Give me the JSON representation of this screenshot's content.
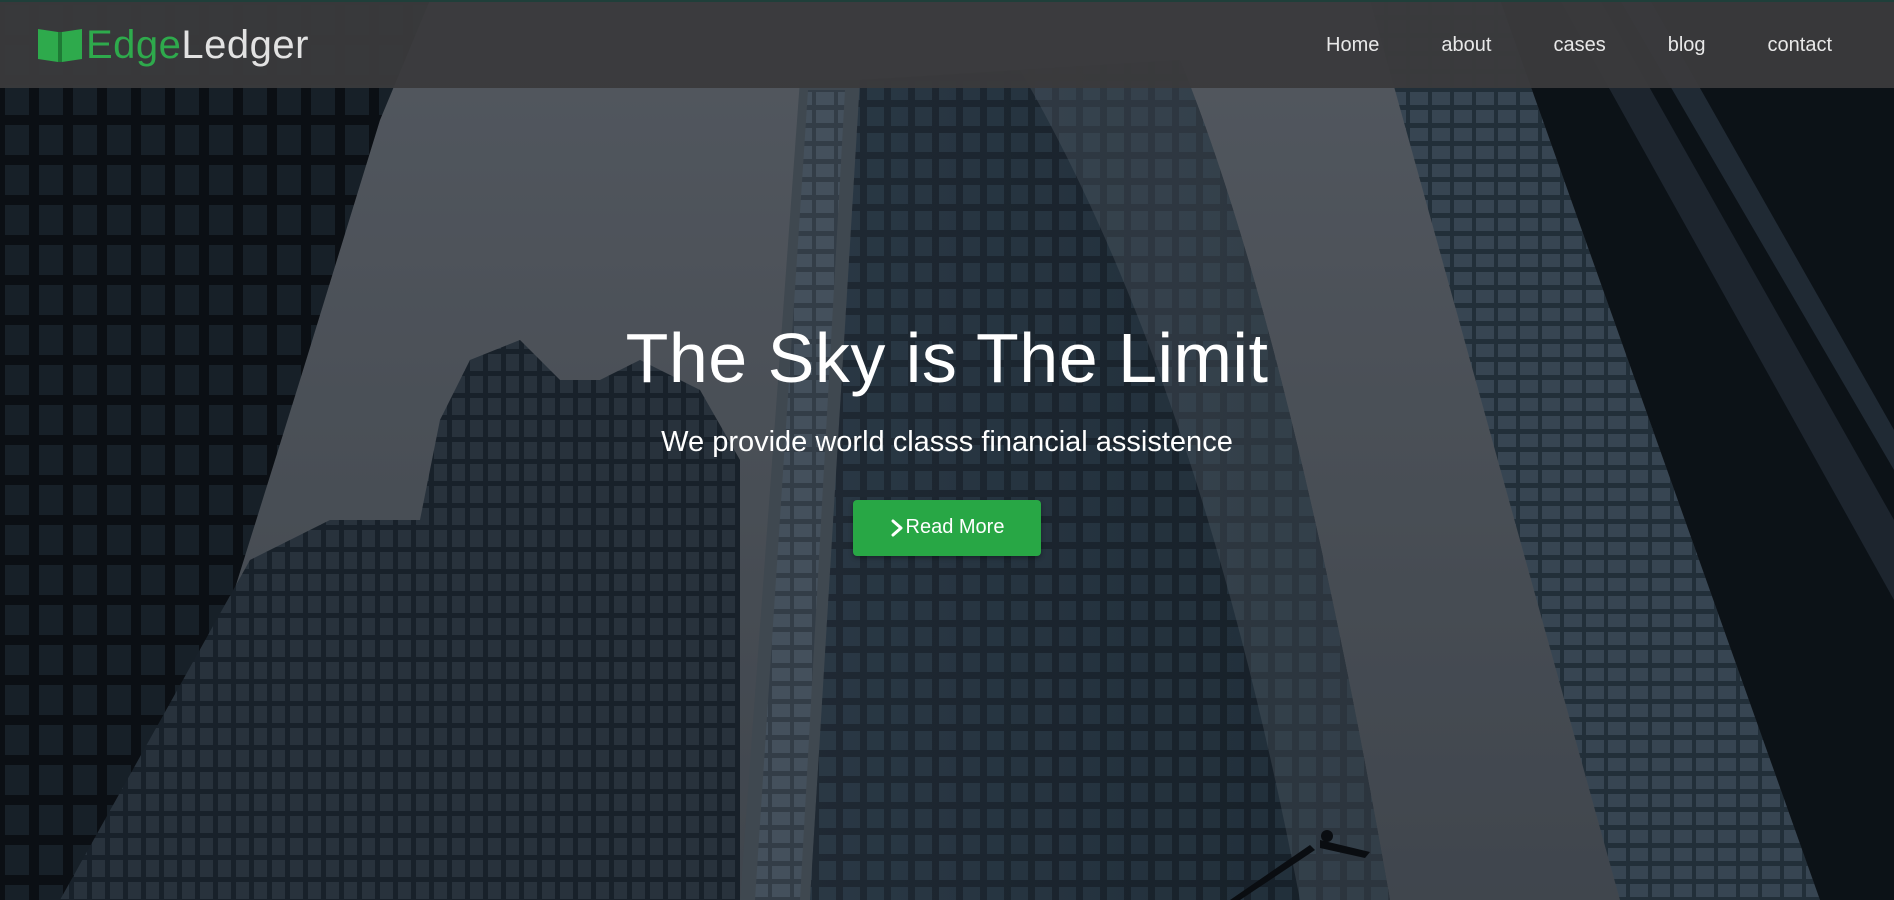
{
  "brand": {
    "part1": "Edge",
    "part2": "Ledger",
    "icon": "open-book-icon",
    "accent_color": "#2eaa4c"
  },
  "nav": {
    "items": [
      {
        "label": "Home"
      },
      {
        "label": "about"
      },
      {
        "label": "cases"
      },
      {
        "label": "blog"
      },
      {
        "label": "contact"
      }
    ]
  },
  "hero": {
    "title": "The Sky is The Limit",
    "subtitle": "We provide world classs financial assistence",
    "cta": {
      "label": "Read More",
      "icon": "chevron-right-icon",
      "color": "#28a745"
    }
  }
}
